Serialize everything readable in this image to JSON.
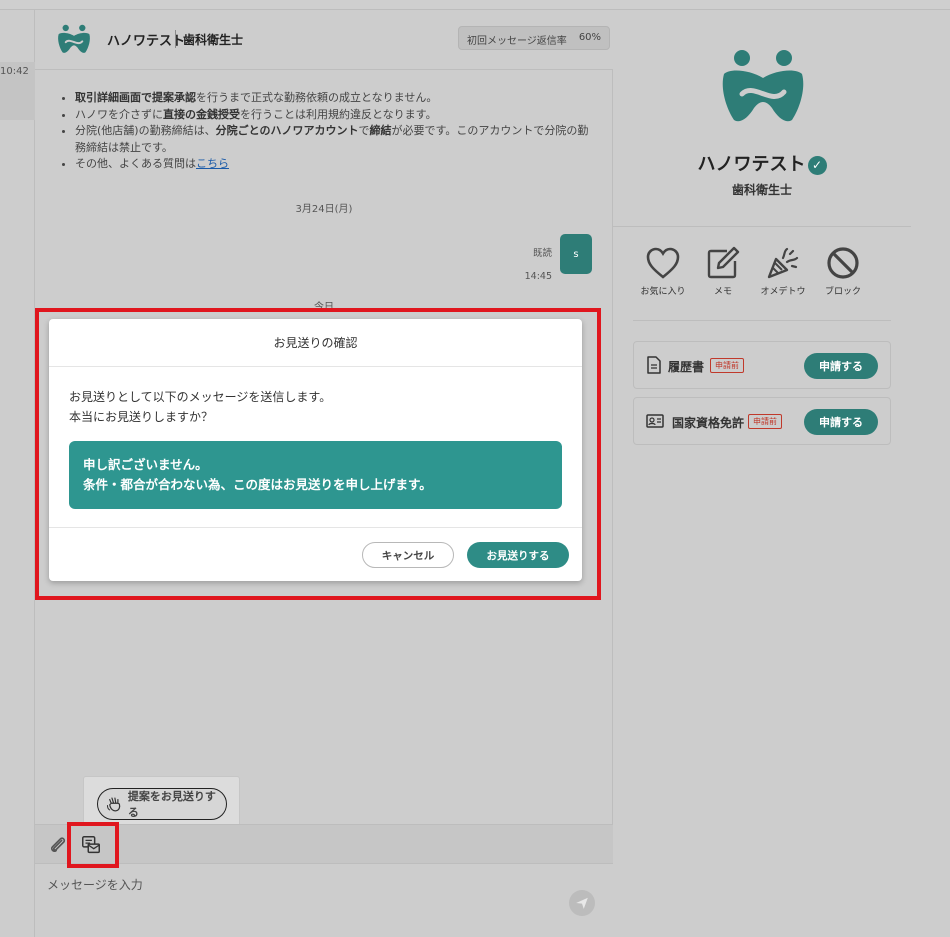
{
  "left_list": {
    "time": "10:42"
  },
  "chat": {
    "header": {
      "name": "ハノワテスト",
      "role": "歯科衛生士",
      "badge_label": "初回メッセージ返信率",
      "badge_value": "60%"
    },
    "notices": [
      {
        "pre": "",
        "b1": "取引詳細画面で提案承認",
        "mid": "を行うまで正式な勤務依頼の成立となりません。",
        "b2": "",
        "post": ""
      },
      {
        "pre": "ハノワを介さずに",
        "b1": "直接の金銭授受",
        "mid": "を行うことは利用規約違反となります。",
        "b2": "",
        "post": ""
      },
      {
        "pre": "分院(他店舗)の勤務締結は、",
        "b1": "分院ごとのハノワアカウント",
        "mid": "で",
        "b2": "締結",
        "post": "が必要です。このアカウントで分院の勤務締結は禁止です。"
      }
    ],
    "faq_text": "その他、よくある質問は",
    "faq_link": "こちら",
    "date1": "3月24日(月)",
    "date2": "今日",
    "message": {
      "status": "既読",
      "time": "14:45",
      "text": "s"
    },
    "float_button": "提案をお見送りする",
    "input_placeholder": "メッセージを入力"
  },
  "modal": {
    "title": "お見送りの確認",
    "line1": "お見送りとして以下のメッセージを送信します。",
    "line2": "本当にお見送りしますか？",
    "message_line1": "申し訳ございません。",
    "message_line2": "条件・都合が合わない為、この度はお見送りを申し上げます。",
    "cancel": "キャンセル",
    "confirm": "お見送りする"
  },
  "profile": {
    "name": "ハノワテスト",
    "verified": "✓",
    "role": "歯科衛生士",
    "actions": [
      {
        "label": "お気に入り",
        "icon": "heart-icon"
      },
      {
        "label": "メモ",
        "icon": "edit-icon"
      },
      {
        "label": "オメデトウ",
        "icon": "party-popper-icon"
      },
      {
        "label": "ブロック",
        "icon": "block-icon"
      }
    ],
    "documents": [
      {
        "label": "履歴書",
        "status": "申請前",
        "button": "申請する",
        "icon": "document-icon"
      },
      {
        "label": "国家資格免許",
        "status": "申請前",
        "button": "申請する",
        "icon": "id-card-icon"
      }
    ]
  },
  "colors": {
    "accent": "#2e7d77",
    "highlight": "#e0161e",
    "message_bg": "#2e9690"
  }
}
